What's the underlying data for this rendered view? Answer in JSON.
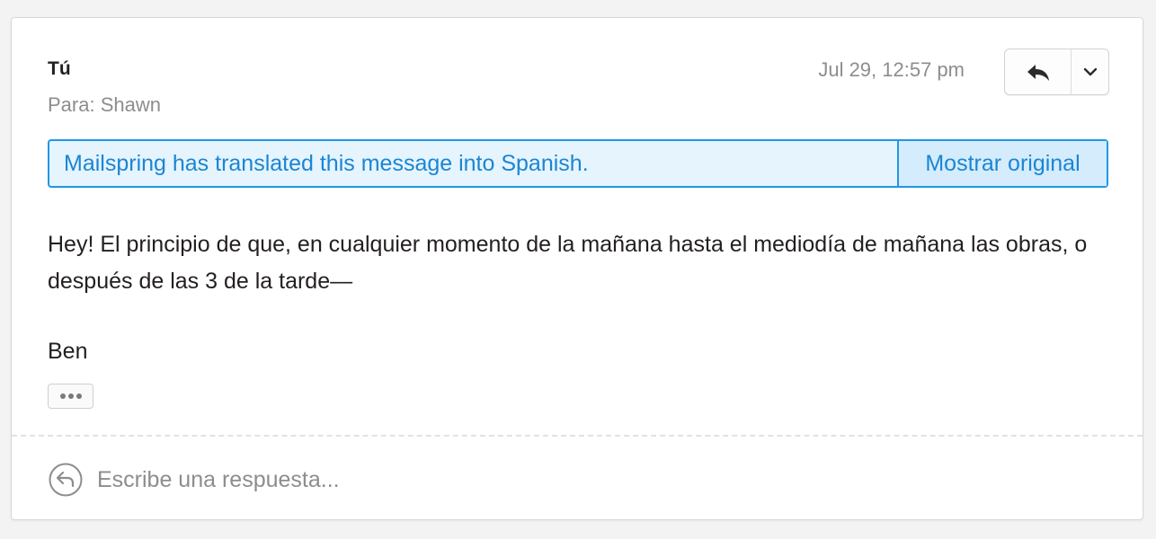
{
  "message": {
    "sender": "Tú",
    "recipients": "Para: Shawn",
    "date": "Jul 29, 12:57 pm"
  },
  "actions": {
    "reply_icon": "reply-icon",
    "more_icon": "chevron-down-icon"
  },
  "translation": {
    "notice": "Mailspring has translated this message into Spanish.",
    "action_label": "Mostrar original",
    "accent_color": "#1f97e6"
  },
  "body": {
    "text": "Hey! El principio de que, en cualquier momento de la mañana hasta el mediodía de mañana las obras, o después de las 3 de la tarde—",
    "signature": "Ben"
  },
  "quoted_toggle": {
    "icon": "ellipsis-icon"
  },
  "reply_box": {
    "icon": "reply-circle-icon",
    "placeholder": "Escribe una respuesta..."
  }
}
